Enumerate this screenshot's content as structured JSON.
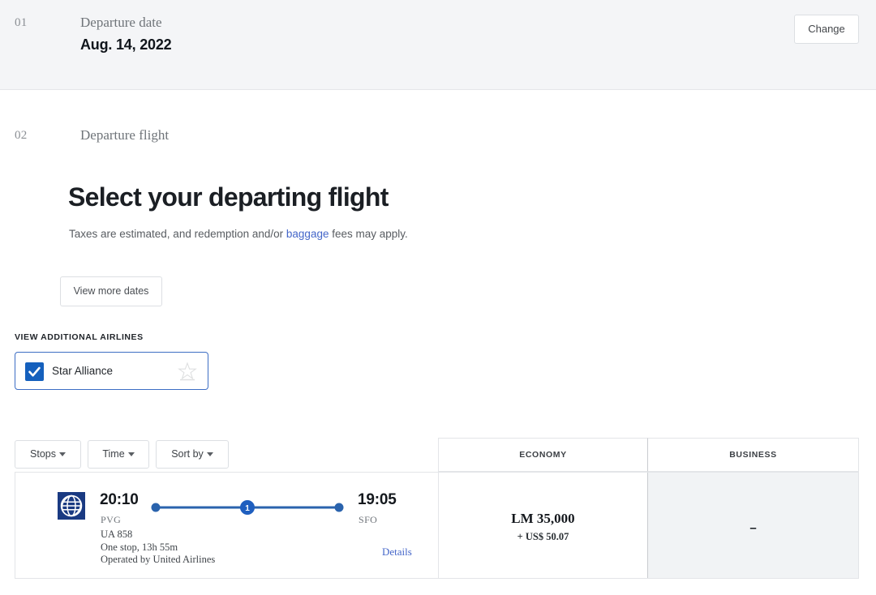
{
  "step_one": {
    "number": "01",
    "label": "Departure date",
    "value": "Aug. 14, 2022",
    "change_button": "Change"
  },
  "step_two": {
    "number": "02",
    "label": "Departure flight",
    "title": "Select your departing flight",
    "subtitle_before": "Taxes are estimated, and redemption and/or ",
    "subtitle_link": "baggage",
    "subtitle_after": " fees may apply.",
    "more_dates_button": "View more dates"
  },
  "airlines_filter": {
    "heading": "VIEW ADDITIONAL AIRLINES",
    "option_label": "Star Alliance",
    "checked": true,
    "logo_icon": "star-alliance-logo"
  },
  "filters": [
    {
      "label": "Stops",
      "icon": "chevron-down-icon"
    },
    {
      "label": "Time",
      "icon": "chevron-down-icon"
    },
    {
      "label": "Sort by",
      "icon": "chevron-down-icon"
    }
  ],
  "table": {
    "columns": [
      "ECONOMY",
      "BUSINESS"
    ],
    "rows": [
      {
        "airline_logo": "united-airlines-globe-logo",
        "depart_time": "20:10",
        "depart_code": "PVG",
        "arrive_time": "19:05",
        "arrive_code": "SFO",
        "stops_marker": "1",
        "flight_number": "UA 858",
        "duration": "One stop, 13h 55m",
        "operated_by": "Operated by United Airlines",
        "details_link": "Details",
        "economy": {
          "miles": "LM 35,000",
          "taxes": "+ US$ 50.07"
        },
        "business": {
          "unavailable": "–"
        }
      }
    ]
  },
  "colors": {
    "brand_blue": "#1560bd",
    "link_blue": "#4466c9",
    "band_bg": "#f4f5f7",
    "business_cell_bg": "#f1f3f5"
  }
}
